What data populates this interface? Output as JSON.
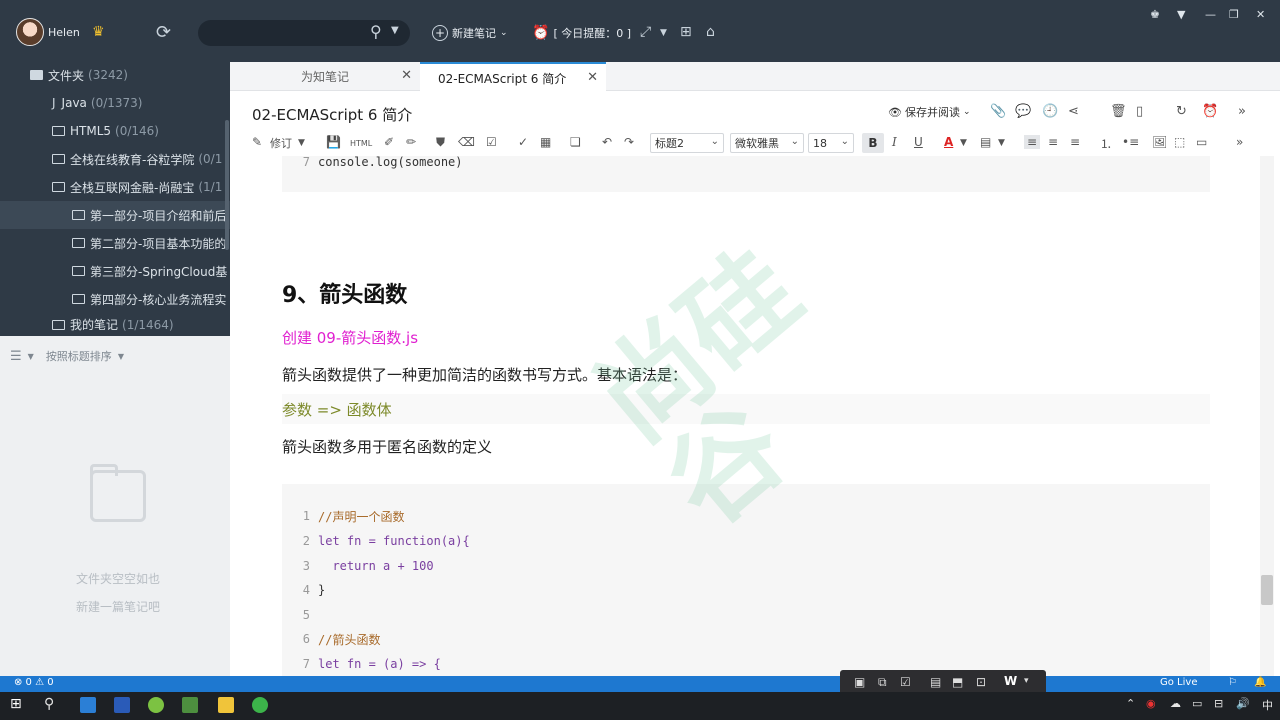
{
  "user": {
    "name": "Helen"
  },
  "toolbar": {
    "search_placeholder": "",
    "new_note_label": "新建笔记",
    "reminder_label": "[ 今日提醒：0 ]"
  },
  "sidebar": {
    "items": [
      {
        "label": "文件夹",
        "count": "(3242)"
      },
      {
        "label": "Java",
        "count": "(0/1373)"
      },
      {
        "label": "HTML5",
        "count": "(0/146)"
      },
      {
        "label": "全栈在线教育-谷粒学院",
        "count": "(0/1"
      },
      {
        "label": "全栈互联网金融-尚融宝",
        "count": "(1/1"
      },
      {
        "label": "第一部分-项目介绍和前后",
        "count": ""
      },
      {
        "label": "第二部分-项目基本功能的",
        "count": ""
      },
      {
        "label": "第三部分-SpringCloud基",
        "count": ""
      },
      {
        "label": "第四部分-核心业务流程实",
        "count": ""
      },
      {
        "label": "我的笔记",
        "count": "(1/1464)"
      }
    ],
    "sort_label": "按照标题排序",
    "empty_line1": "文件夹空空如也",
    "empty_line2": "新建一篇笔记吧"
  },
  "tabs": [
    {
      "label": "为知笔记"
    },
    {
      "label": "02-ECMAScript 6 简介"
    }
  ],
  "note": {
    "title": "02-ECMAScript 6 简介",
    "save_read_label": "保存并阅读"
  },
  "editor_toolbar": {
    "revise_label": "修订",
    "heading_select": "标题2",
    "font_select": "微软雅黑",
    "size_select": "18"
  },
  "doc": {
    "prev_code_line_number": "7",
    "prev_code_text": "console.log(someone)",
    "heading": "9、箭头函数",
    "create_file": "创建 09-箭头函数.js",
    "para1": "箭头函数提供了一种更加简洁的函数书写方式。基本语法是：",
    "syntax": "参数 => 函数体",
    "para2": "箭头函数多用于匿名函数的定义",
    "code_lines": [
      {
        "n": "1",
        "t": "//声明一个函数"
      },
      {
        "n": "2",
        "t": "let fn = function(a){"
      },
      {
        "n": "3",
        "t": "  return a + 100"
      },
      {
        "n": "4",
        "t": "}"
      },
      {
        "n": "5",
        "t": ""
      },
      {
        "n": "6",
        "t": "//箭头函数"
      },
      {
        "n": "7",
        "t": "let fn = (a) => {"
      }
    ]
  },
  "status_bar": {
    "problems": "⊗ 0 ⚠ 0",
    "go_live": "Go Live"
  },
  "taskbar": {
    "ime": "中"
  },
  "colors": {
    "sidebar_bg": "#2f3a46",
    "accent": "#2a8bd6",
    "link_magenta": "#e020d0"
  }
}
